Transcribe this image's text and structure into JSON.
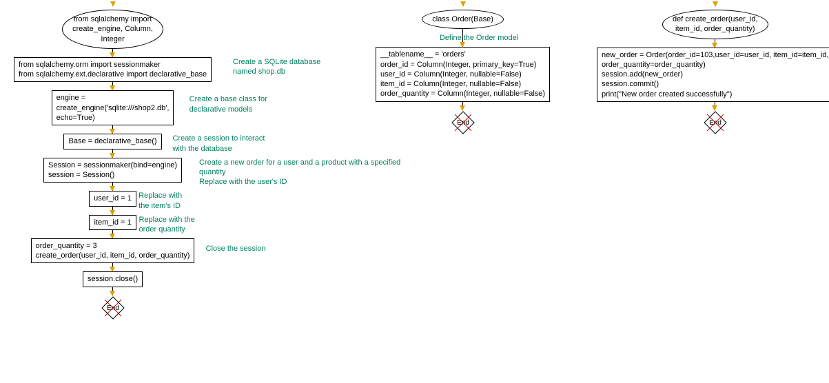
{
  "flow1": {
    "start": "from sqlalchemy import\ncreate_engine, Column,\nInteger",
    "n1": "from sqlalchemy.orm import sessionmaker\nfrom sqlalchemy.ext.declarative import declarative_base",
    "a1": "Create a SQLite database\nnamed shop.db",
    "n2": "engine =\ncreate_engine('sqlite:///shop2.db',\necho=True)",
    "a2": "Create a base class for\ndeclarative models",
    "n3": "Base = declarative_base()",
    "a3": "Create a session to interact\nwith the database",
    "n4": "Session = sessionmaker(bind=engine)\nsession = Session()",
    "a4": "Create a new order for a user and a product with a specified\nquantity\nReplace with the user's ID",
    "n5": "user_id = 1",
    "a5": "Replace with\nthe item's ID",
    "n6": "item_id = 1",
    "a6": "Replace with the\norder quantity",
    "n7": "order_quantity = 3\ncreate_order(user_id, item_id, order_quantity)",
    "a7": "Close the session",
    "n8": "session.close()",
    "end": "End"
  },
  "flow2": {
    "start": "class Order(Base)",
    "a1": "Define the Order model",
    "n1": "__tablename__ = 'orders'\norder_id = Column(Integer, primary_key=True)\nuser_id = Column(Integer, nullable=False)\nitem_id = Column(Integer, nullable=False)\norder_quantity = Column(Integer, nullable=False)",
    "end": "End"
  },
  "flow3": {
    "start": "def create_order(user_id,\nitem_id, order_quantity)",
    "n1": "new_order = Order(order_id=103,user_id=user_id, item_id=item_id,\norder_quantity=order_quantity)\nsession.add(new_order)\nsession.commit()\nprint(\"New order created successfully\")",
    "end": "End"
  }
}
